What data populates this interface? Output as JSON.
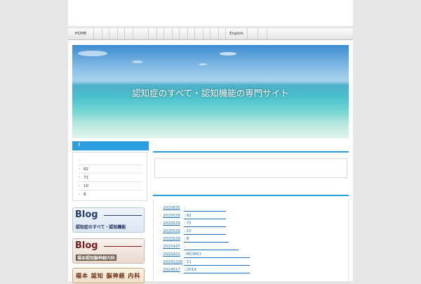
{
  "nav": {
    "home": "HOME",
    "english": "English"
  },
  "hero": {
    "title": "認知症のすべて・認知機能の専門サイト"
  },
  "sidebar": {
    "heading": "!",
    "items": [
      "",
      "82",
      "71",
      "10",
      "8"
    ]
  },
  "banners": [
    {
      "big": "Blog",
      "sub": "認知症のすべて・認知機能"
    },
    {
      "big": "Blog",
      "sub": "福本認知脳神経内科"
    },
    {
      "big": "福本 認知 脳神経 内科"
    }
  ],
  "news": [
    {
      "date": "2015825",
      "title": ":"
    },
    {
      "date": "2015529",
      "title": ": 82"
    },
    {
      "date": "2015529",
      "title": ": 71"
    },
    {
      "date": "2015529",
      "title": ": 10"
    },
    {
      "date": "2015529",
      "title": ": 8"
    },
    {
      "date": "2015427",
      "title": ":"
    },
    {
      "date": "2015421",
      "title": ": MCIMCI"
    },
    {
      "date": "20141226",
      "title": ": 11"
    },
    {
      "date": "2014517",
      "title": ": 2014"
    }
  ],
  "colors": {
    "accent": "#2b9ee0",
    "link": "#1a6fb8"
  }
}
